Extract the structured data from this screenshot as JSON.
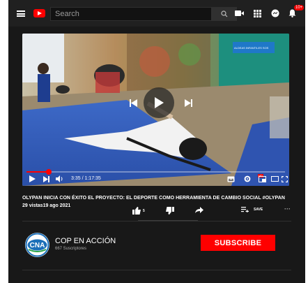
{
  "header": {
    "search_placeholder": "Search",
    "notification_count": "10+"
  },
  "player": {
    "time": "3:35 / 1:17:35",
    "progress_fraction": 0.046,
    "scene_sign_text": "ALDEAS INFANTILES SOS"
  },
  "video": {
    "title": "OLYPAN INICIA CON ÉXITO EL PROYECTO: EL DEPORTE COMO HERRAMIENTA DE CAMBIO SOCIAL #OLYPAN",
    "meta": "29 vistas19 ago 2021",
    "like_count": "5",
    "save_label": "SAVE"
  },
  "channel": {
    "name": "COP EN ACCIÓN",
    "subscribers": "667 Suscriptores",
    "subscribe_label": "SUBSCRIBE",
    "logo_text": "CNA"
  },
  "colors": {
    "accent": "#ff0000",
    "background": "#181818",
    "topbar": "#202020"
  }
}
